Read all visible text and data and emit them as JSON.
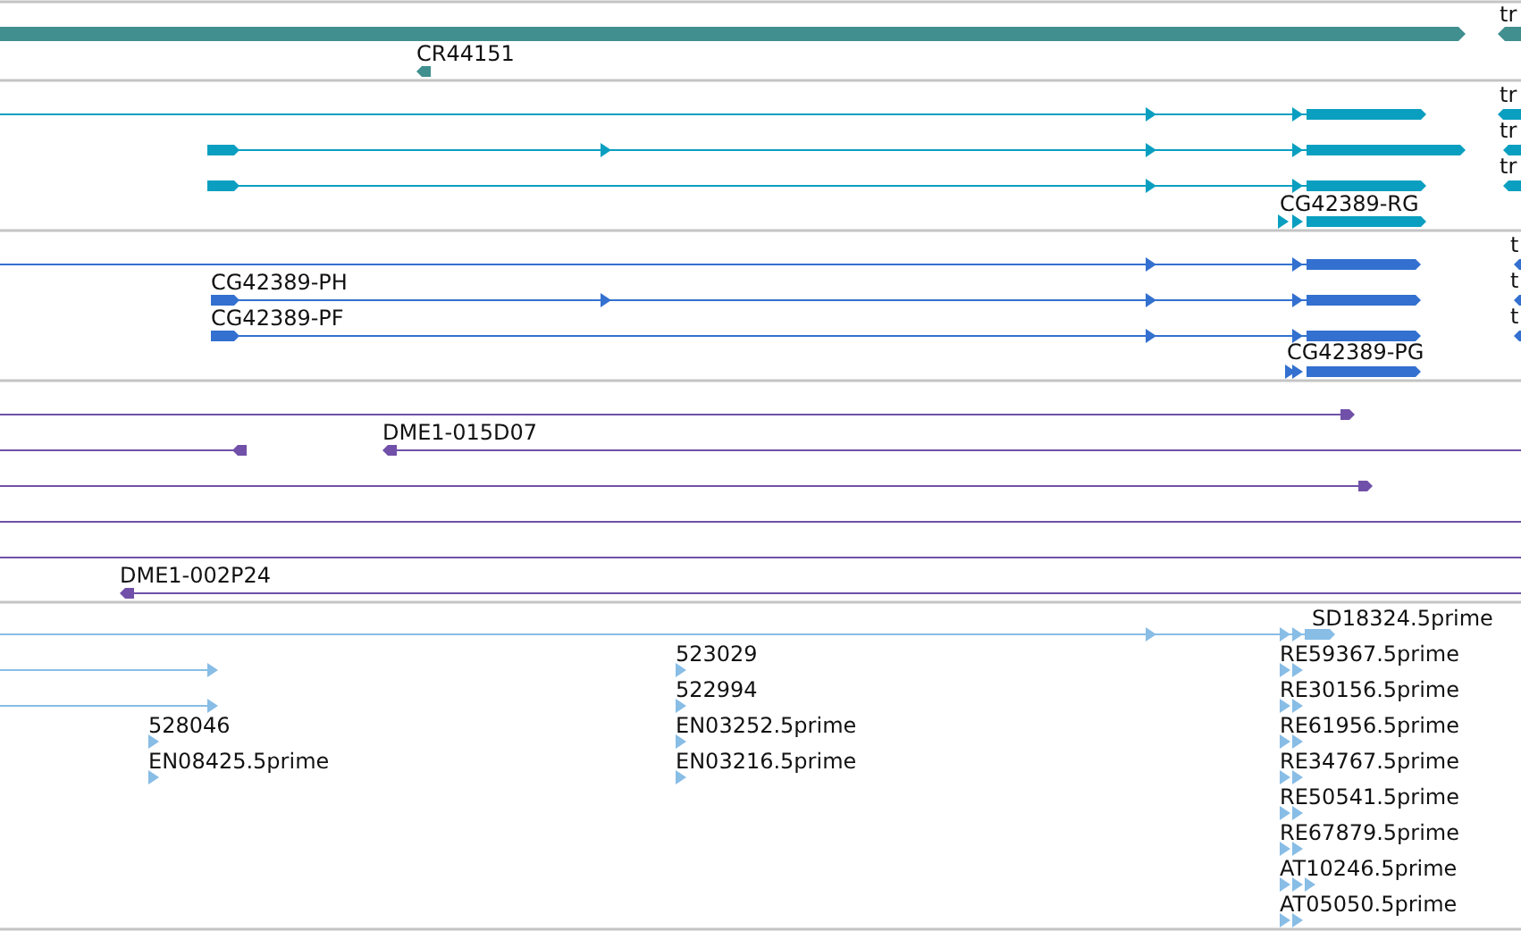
{
  "tracks": [
    {
      "color": "#418f8f",
      "labels": [
        "tr",
        "CR44151"
      ]
    },
    {
      "color": "#0a9fc0",
      "labels": [
        "tr",
        "tr",
        "tr",
        "CG42389-RG"
      ]
    },
    {
      "color": "#3370cf",
      "labels": [
        "t",
        "CG42389-PH",
        "t",
        "CG42389-PF",
        "t",
        "CG42389-PG"
      ]
    },
    {
      "color": "#7050a8",
      "labels": [
        "DME1-015D07",
        "DME1-002P24"
      ]
    },
    {
      "color": "#88bde6",
      "labels": [
        "SD18324.5prime",
        "523029",
        "RE59367.5prime",
        "522994",
        "RE30156.5prime",
        "528046",
        "EN03252.5prime",
        "RE61956.5prime",
        "EN08425.5prime",
        "EN03216.5prime",
        "RE34767.5prime",
        "RE50541.5prime",
        "RE67879.5prime",
        "AT10246.5prime",
        "AT05050.5prime"
      ]
    }
  ]
}
